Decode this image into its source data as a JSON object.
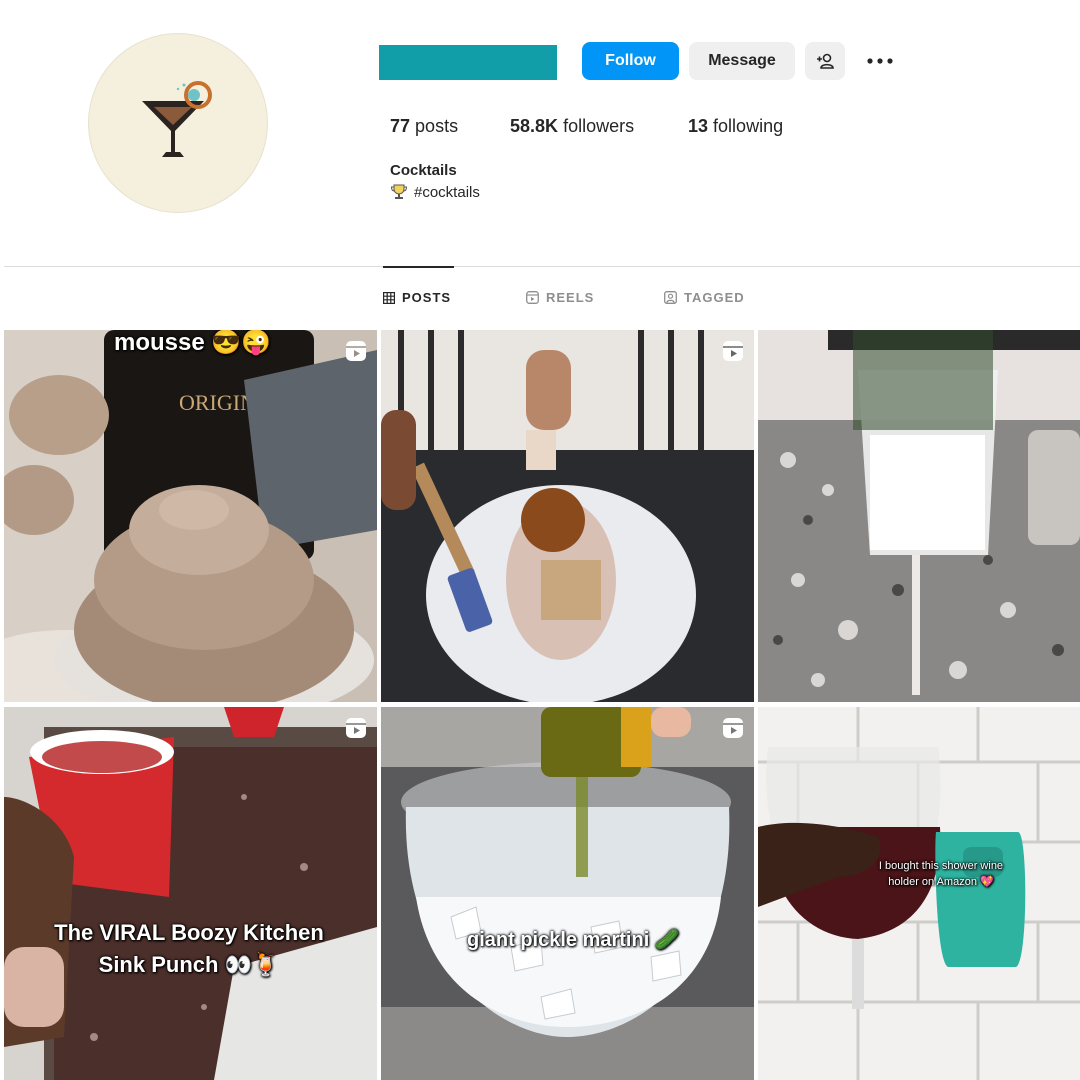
{
  "profile": {
    "stats": {
      "posts_count": "77",
      "posts_label": "posts",
      "followers_count": "58.8K",
      "followers_label": "followers",
      "following_count": "13",
      "following_label": "following"
    },
    "bio": {
      "name": "Cocktails",
      "tag": "#cocktails"
    },
    "buttons": {
      "follow": "Follow",
      "message": "Message"
    }
  },
  "tabs": [
    {
      "label": "POSTS",
      "icon": "grid-icon",
      "active": true
    },
    {
      "label": "REELS",
      "icon": "reels-icon",
      "active": false
    },
    {
      "label": "TAGGED",
      "icon": "tagged-icon",
      "active": false
    }
  ],
  "posts": [
    {
      "caption": "mousse 😎😜",
      "is_reel": true
    },
    {
      "caption": "",
      "is_reel": true
    },
    {
      "caption": "",
      "is_reel": false
    },
    {
      "caption": "The VIRAL Boozy Kitchen Sink Punch 👀🍹",
      "is_reel": true
    },
    {
      "caption": "giant pickle martini 🥒",
      "is_reel": true
    },
    {
      "caption": "I bought this shower wine holder on Amazon 💖",
      "is_reel": false
    }
  ],
  "colors": {
    "follow_button": "#0095f6",
    "username_redaction": "#119ea8",
    "secondary_button": "#efefef"
  }
}
